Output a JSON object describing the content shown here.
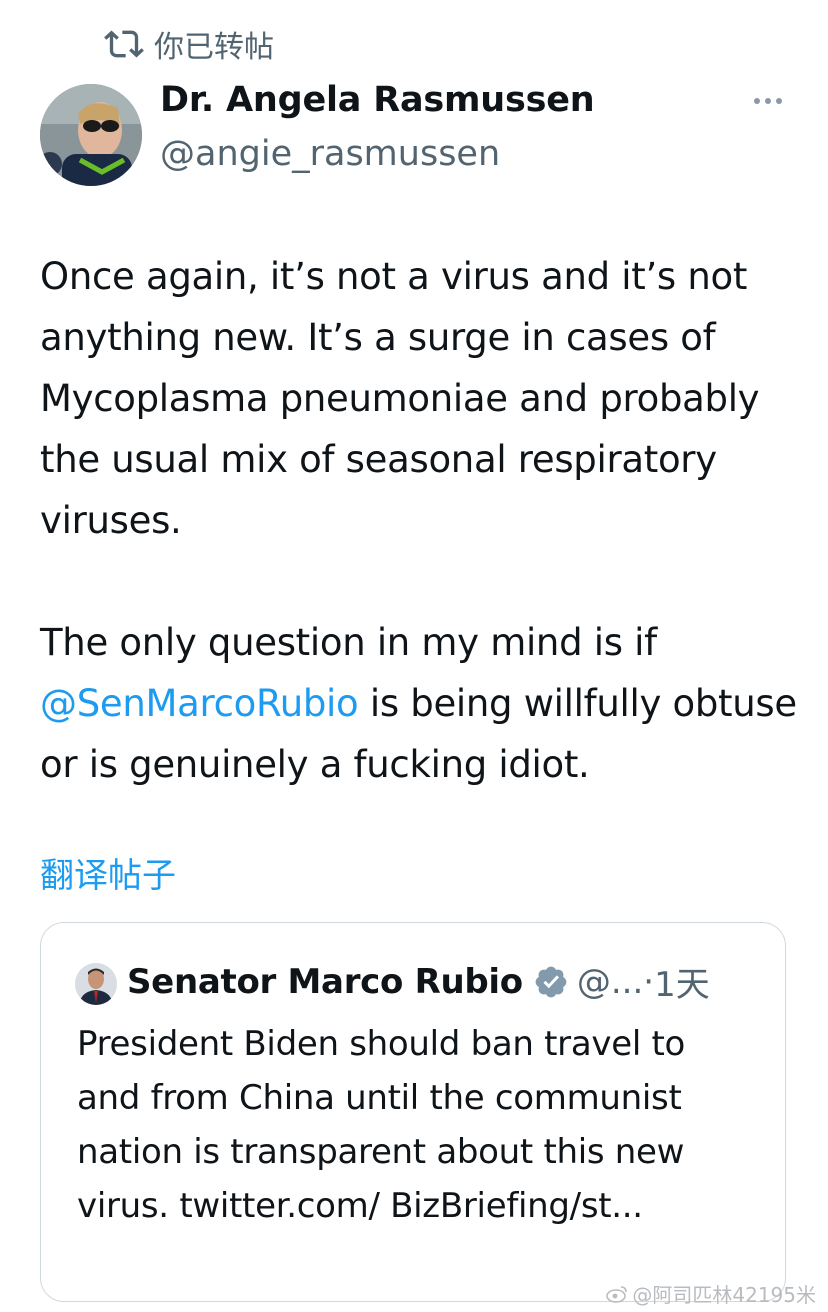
{
  "retweet": {
    "label": "你已转帖",
    "icon": "retweet-icon"
  },
  "author": {
    "name": "Dr. Angela Rasmussen",
    "handle": "@angie_rasmussen"
  },
  "tweet": {
    "paragraph1": "Once again, it’s not a virus and it’s not anything new. It’s a surge in cases of Mycoplasma pneumoniae and probably the usual mix of seasonal respiratory viruses.",
    "paragraph2_start": "The only question in my mind is if",
    "mention": "@SenMarcoRubio",
    "paragraph2_end": "is being willfully obtuse or is genuinely a fucking idiot."
  },
  "translate_label": "翻译帖子",
  "quote": {
    "name": "Senator Marco Rubio",
    "handle_truncated": "@...",
    "separator": "·",
    "time": "1天",
    "text": "President Biden should ban travel to and from China until the communist nation is transparent about this new virus. twitter.com/ BizBriefing/st..."
  },
  "watermark": "@阿司匹林42195米",
  "colors": {
    "link": "#1d9bf0",
    "secondary": "#536471",
    "border": "#cfd9de"
  }
}
